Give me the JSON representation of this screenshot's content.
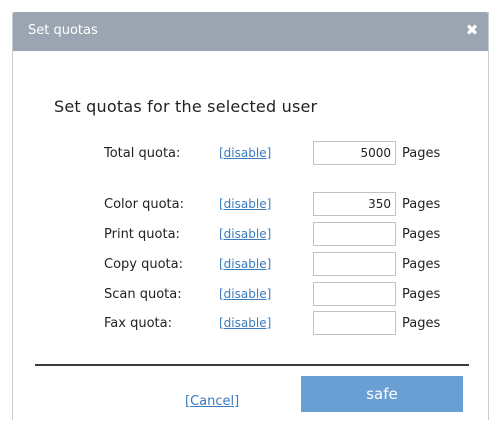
{
  "dialog": {
    "title": "Set quotas",
    "close_icon": "close-icon",
    "heading": "Set quotas for the selected user"
  },
  "quotas": [
    {
      "label": "Total quota:",
      "link": "[disable]",
      "value": "5000",
      "unit": "Pages"
    },
    {
      "label": "Color quota:",
      "link": "[disable]",
      "value": "350",
      "unit": "Pages"
    },
    {
      "label": "Print quota:",
      "link": "[disable]",
      "value": "",
      "unit": "Pages"
    },
    {
      "label": "Copy quota:",
      "link": "[disable]",
      "value": "",
      "unit": "Pages"
    },
    {
      "label": "Scan quota:",
      "link": "[disable]",
      "value": "",
      "unit": "Pages"
    },
    {
      "label": "Fax quota:",
      "link": "[disable]",
      "value": "",
      "unit": "Pages"
    }
  ],
  "footer": {
    "cancel_label": "[Cancel]",
    "save_label": "safe"
  },
  "colors": {
    "titlebar": "#9ba5b1",
    "link": "#3a7bbd",
    "primary_button": "#6a9fd4"
  }
}
